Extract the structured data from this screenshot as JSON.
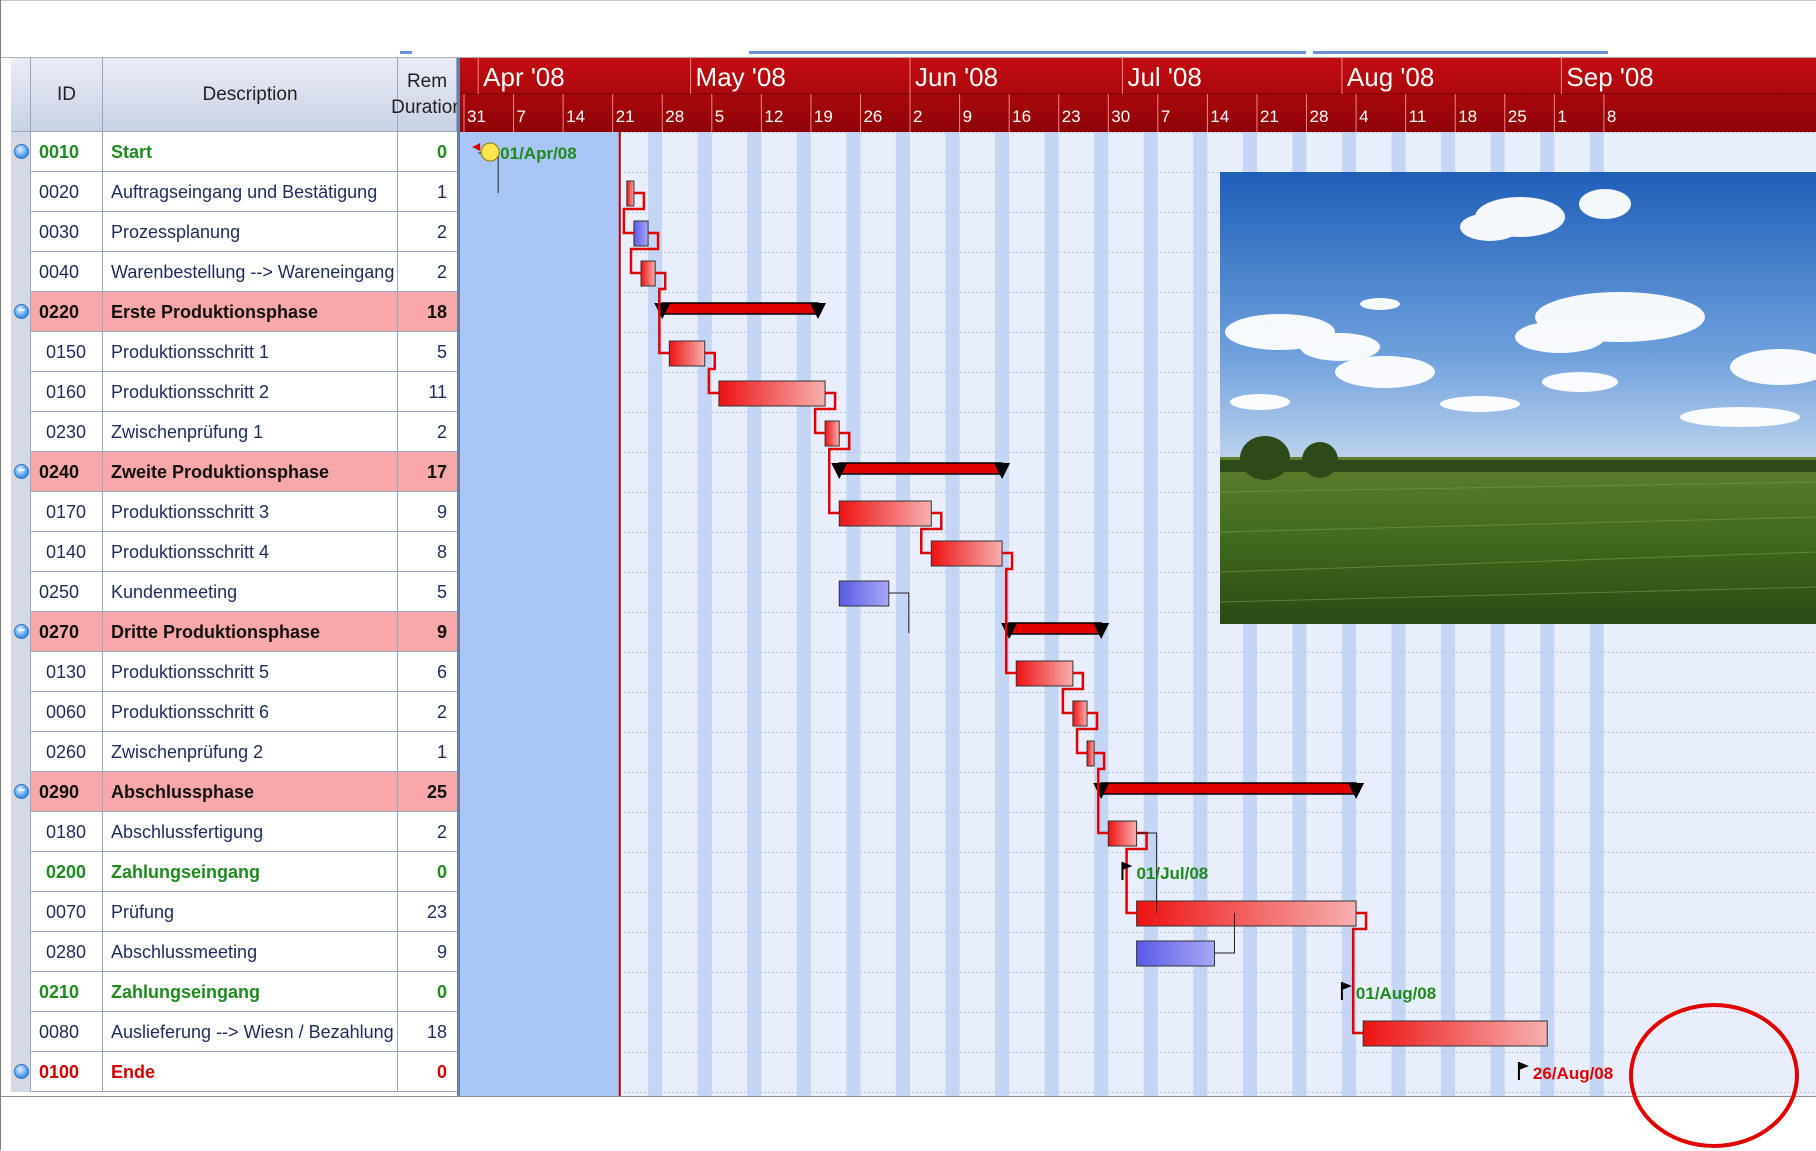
{
  "grid": {
    "headers": {
      "id": "ID",
      "description": "Description",
      "rem_line1": "Rem",
      "rem_line2": "Duration"
    },
    "rows": [
      {
        "id": "0010",
        "desc": "Start",
        "dur": "0",
        "type": "milestone",
        "toggle": "dot"
      },
      {
        "id": "0020",
        "desc": "Auftragseingang und Bestätigung",
        "dur": "1",
        "type": "task"
      },
      {
        "id": "0030",
        "desc": "Prozessplanung",
        "dur": "2",
        "type": "task"
      },
      {
        "id": "0040",
        "desc": "Warenbestellung --> Wareneingang",
        "dur": "2",
        "type": "task"
      },
      {
        "id": "0220",
        "desc": "Erste Produktionsphase",
        "dur": "18",
        "type": "summary",
        "toggle": "minus"
      },
      {
        "id": "0150",
        "desc": "Produktionsschritt 1",
        "dur": "5",
        "type": "task",
        "sub": true
      },
      {
        "id": "0160",
        "desc": "Produktionsschritt 2",
        "dur": "11",
        "type": "task",
        "sub": true
      },
      {
        "id": "0230",
        "desc": "Zwischenprüfung 1",
        "dur": "2",
        "type": "task",
        "sub": true
      },
      {
        "id": "0240",
        "desc": "Zweite Produktionsphase",
        "dur": "17",
        "type": "summary",
        "toggle": "minus"
      },
      {
        "id": "0170",
        "desc": "Produktionsschritt 3",
        "dur": "9",
        "type": "task",
        "sub": true
      },
      {
        "id": "0140",
        "desc": "Produktionsschritt 4",
        "dur": "8",
        "type": "task",
        "sub": true
      },
      {
        "id": "0250",
        "desc": "Kundenmeeting",
        "dur": "5",
        "type": "task"
      },
      {
        "id": "0270",
        "desc": "Dritte Produktionsphase",
        "dur": "9",
        "type": "summary",
        "toggle": "minus"
      },
      {
        "id": "0130",
        "desc": "Produktionsschritt 5",
        "dur": "6",
        "type": "task",
        "sub": true
      },
      {
        "id": "0060",
        "desc": "Produktionsschritt 6",
        "dur": "2",
        "type": "task",
        "sub": true
      },
      {
        "id": "0260",
        "desc": "Zwischenprüfung 2",
        "dur": "1",
        "type": "task",
        "sub": true
      },
      {
        "id": "0290",
        "desc": "Abschlussphase",
        "dur": "25",
        "type": "summary",
        "toggle": "minus"
      },
      {
        "id": "0180",
        "desc": "Abschlussfertigung",
        "dur": "2",
        "type": "task",
        "sub": true
      },
      {
        "id": "0200",
        "desc": "Zahlungseingang",
        "dur": "0",
        "type": "milestone",
        "sub": true
      },
      {
        "id": "0070",
        "desc": "Prüfung",
        "dur": "23",
        "type": "task",
        "sub": true
      },
      {
        "id": "0280",
        "desc": "Abschlussmeeting",
        "dur": "9",
        "type": "task",
        "sub": true
      },
      {
        "id": "0210",
        "desc": "Zahlungseingang",
        "dur": "0",
        "type": "milestone"
      },
      {
        "id": "0080",
        "desc": "Auslieferung --> Wiesn / Bezahlung",
        "dur": "18",
        "type": "task"
      },
      {
        "id": "0100",
        "desc": "Ende",
        "dur": "0",
        "type": "endm",
        "toggle": "dot"
      }
    ]
  },
  "timeline": {
    "months": [
      "Apr '08",
      "May '08",
      "Jun '08",
      "Jul '08",
      "Aug '08",
      "Sep '08"
    ],
    "month_start_day": [
      1,
      31,
      62,
      92,
      123,
      154
    ],
    "weeks": [
      "31",
      "7",
      "14",
      "21",
      "28",
      "5",
      "12",
      "19",
      "26",
      "2",
      "9",
      "16",
      "23",
      "30",
      "7",
      "14",
      "21",
      "28",
      "4",
      "11",
      "18",
      "25",
      "1",
      "8"
    ],
    "first_week_day": -1,
    "status_date_day": 21,
    "past_until_day": 21
  },
  "bars": [
    {
      "row": 1,
      "start": 22,
      "end": 23,
      "kind": "red"
    },
    {
      "row": 2,
      "start": 23,
      "end": 25,
      "kind": "blue"
    },
    {
      "row": 3,
      "start": 24,
      "end": 26,
      "kind": "red"
    },
    {
      "row": 4,
      "start": 27,
      "end": 49,
      "kind": "summary"
    },
    {
      "row": 5,
      "start": 28,
      "end": 33,
      "kind": "red"
    },
    {
      "row": 6,
      "start": 35,
      "end": 50,
      "kind": "red"
    },
    {
      "row": 7,
      "start": 50,
      "end": 52,
      "kind": "red"
    },
    {
      "row": 8,
      "start": 52,
      "end": 75,
      "kind": "summary"
    },
    {
      "row": 9,
      "start": 52,
      "end": 65,
      "kind": "red"
    },
    {
      "row": 10,
      "start": 65,
      "end": 75,
      "kind": "red"
    },
    {
      "row": 11,
      "start": 52,
      "end": 59,
      "kind": "blue"
    },
    {
      "row": 12,
      "start": 76,
      "end": 89,
      "kind": "summary"
    },
    {
      "row": 13,
      "start": 77,
      "end": 85,
      "kind": "red"
    },
    {
      "row": 14,
      "start": 85,
      "end": 87,
      "kind": "red"
    },
    {
      "row": 15,
      "start": 87,
      "end": 88,
      "kind": "red"
    },
    {
      "row": 16,
      "start": 89,
      "end": 125,
      "kind": "summary"
    },
    {
      "row": 17,
      "start": 90,
      "end": 94,
      "kind": "red"
    },
    {
      "row": 19,
      "start": 94,
      "end": 125,
      "kind": "red"
    },
    {
      "row": 20,
      "start": 94,
      "end": 105,
      "kind": "blue"
    },
    {
      "row": 22,
      "start": 126,
      "end": 152,
      "kind": "red"
    }
  ],
  "milestones": [
    {
      "row": 0,
      "day": 1,
      "label": "01/Apr/08",
      "color": "#1e8a1e"
    },
    {
      "row": 18,
      "day": 92,
      "label": "01/Jul/08",
      "color": "#1e8a1e"
    },
    {
      "row": 21,
      "day": 123,
      "label": "01/Aug/08",
      "color": "#1e8a1e"
    },
    {
      "row": 23,
      "day": 148,
      "label": "26/Aug/08",
      "color": "#e00000"
    }
  ],
  "colors": {
    "header_red": "#a8050a",
    "summary_row": "#f8a8a8",
    "past_blue": "#a9c6f7",
    "status_line": "#b00000"
  }
}
